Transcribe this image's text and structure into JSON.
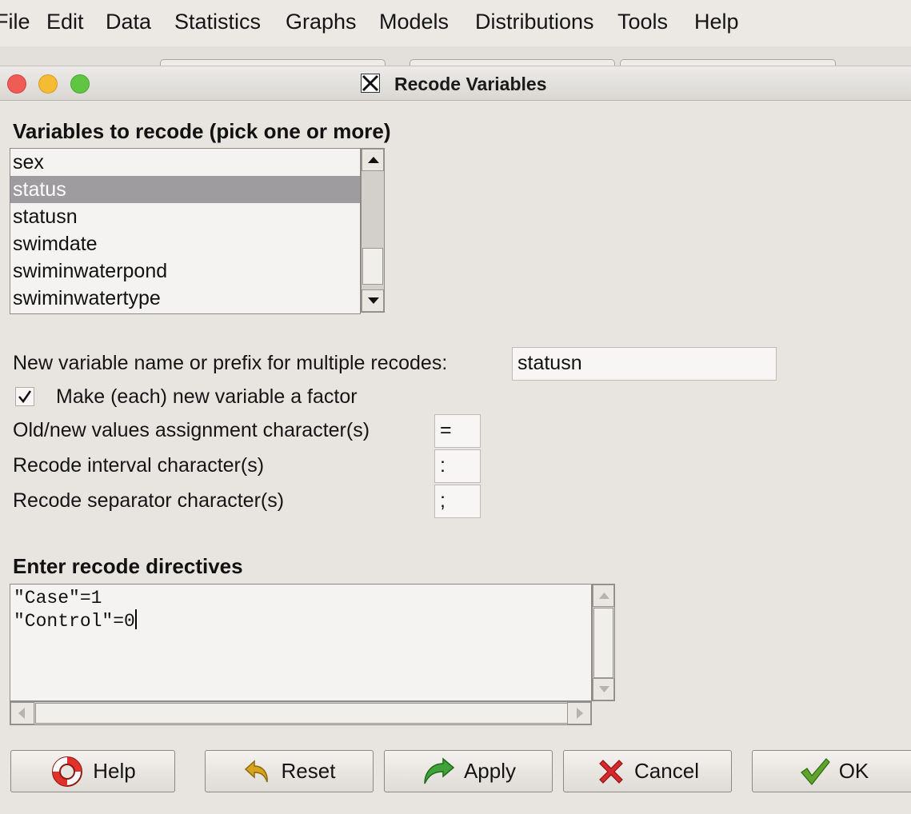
{
  "menubar": {
    "items": [
      "File",
      "Edit",
      "Data",
      "Statistics",
      "Graphs",
      "Models",
      "Distributions",
      "Tools",
      "Help"
    ]
  },
  "window": {
    "title": "Recode Variables"
  },
  "variables": {
    "heading": "Variables to recode (pick one or more)",
    "items": [
      "sex",
      "status",
      "statusn",
      "swimdate",
      "swiminwaterpond",
      "swiminwatertype"
    ],
    "selected": "status"
  },
  "form": {
    "new_name_label": "New variable name or prefix for multiple recodes:",
    "new_name_value": "statusn",
    "factor_label": "Make (each) new variable a factor",
    "factor_checked": true,
    "assign_label": "Old/new values assignment character(s)",
    "assign_value": "=",
    "interval_label": "Recode interval character(s)",
    "interval_value": ":",
    "separator_label": "Recode separator character(s)",
    "separator_value": ";"
  },
  "directives": {
    "heading": "Enter recode directives",
    "lines": [
      "\"Case\"=1",
      "\"Control\"=0"
    ]
  },
  "buttons": {
    "help": "Help",
    "reset": "Reset",
    "apply": "Apply",
    "cancel": "Cancel",
    "ok": "OK"
  },
  "colors": {
    "selection": "#9f9ca0",
    "close": "#ef5b55",
    "minimize": "#f5bb33",
    "maximize": "#60c542",
    "cancel_icon": "#d9282b",
    "ok_icon": "#5ea32c",
    "apply_icon": "#3fa33a",
    "reset_icon": "#d9a21b"
  }
}
